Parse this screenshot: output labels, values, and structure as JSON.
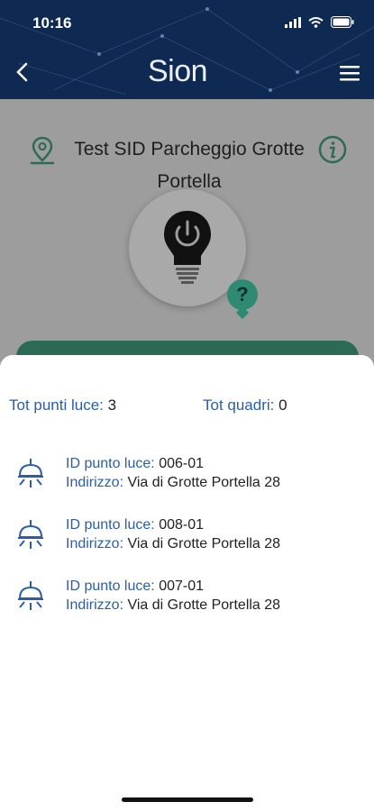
{
  "status": {
    "time": "10:16"
  },
  "header": {
    "logo": "Sion"
  },
  "location": {
    "title": "Test SID Parcheggio Grotte Portella"
  },
  "totals": {
    "punti_label": "Tot punti luce:",
    "punti_value": "3",
    "quadri_label": "Tot quadri:",
    "quadri_value": "0"
  },
  "items": [
    {
      "id_label": "ID punto luce:",
      "id_value": "006-01",
      "addr_label": "Indirizzo:",
      "addr_value": "Via di Grotte Portella 28"
    },
    {
      "id_label": "ID punto luce:",
      "id_value": "008-01",
      "addr_label": "Indirizzo:",
      "addr_value": "Via di Grotte Portella 28"
    },
    {
      "id_label": "ID punto luce:",
      "id_value": "007-01",
      "addr_label": "Indirizzo:",
      "addr_value": "Via di Grotte Portella 28"
    }
  ],
  "colors": {
    "header": "#0f2a52",
    "accent_blue": "#2b5ea7",
    "accent_green": "#2e8a73"
  },
  "icons": [
    "back-icon",
    "menu-icon",
    "location-pin-icon",
    "info-icon",
    "bulb-power-icon",
    "help-icon",
    "street-lamp-icon"
  ]
}
